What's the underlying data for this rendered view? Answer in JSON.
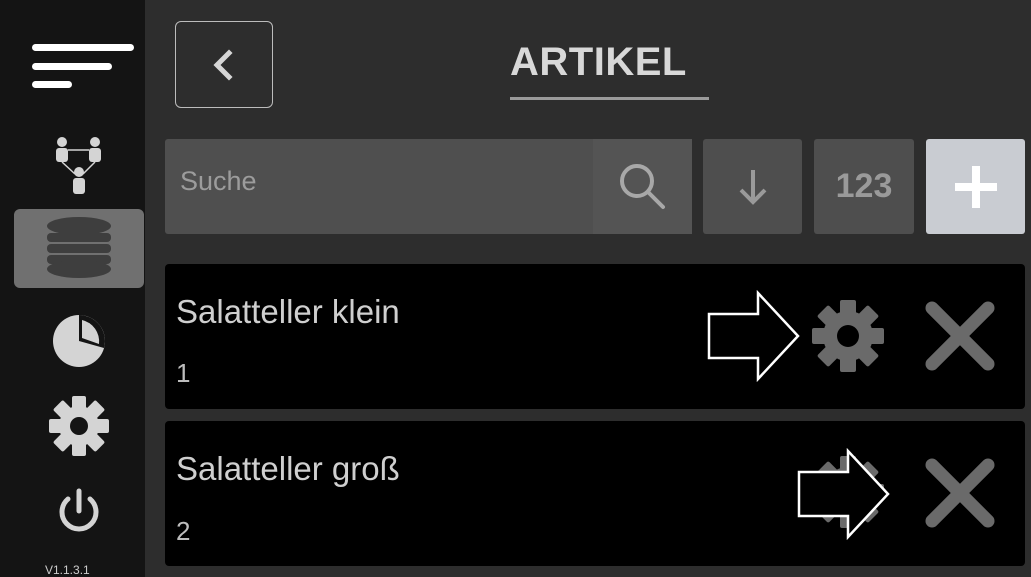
{
  "app": {
    "version": "V1.1.3.1"
  },
  "header": {
    "title": "ARTIKEL",
    "back_icon": "chevron-left-icon"
  },
  "sidebar": {
    "items": [
      {
        "name": "menu",
        "icon": "hamburger-icon"
      },
      {
        "name": "users",
        "icon": "users-network-icon"
      },
      {
        "name": "articles",
        "icon": "database-icon",
        "active": true
      },
      {
        "name": "statistics",
        "icon": "pie-chart-icon"
      },
      {
        "name": "settings",
        "icon": "gear-icon"
      },
      {
        "name": "power",
        "icon": "power-icon"
      }
    ]
  },
  "toolbar": {
    "search_placeholder": "Suche",
    "sort_icon": "arrow-down-icon",
    "numeric_sort_label": "123",
    "add_icon": "plus-icon"
  },
  "articles": [
    {
      "name": "Salatteller klein",
      "number": "1"
    },
    {
      "name": "Salatteller groß",
      "number": "2"
    }
  ],
  "colors": {
    "sidebar_bg": "#141414",
    "main_bg": "#2d2d2d",
    "active_item": "#707070",
    "row_bg": "#000000",
    "add_button_bg": "#c9ccd2"
  }
}
